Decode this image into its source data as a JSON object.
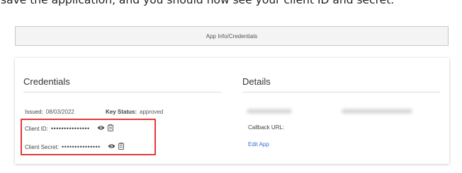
{
  "doc": {
    "text": "save the application, and you should now see your client ID and secret."
  },
  "tab": {
    "label": "App Info/Credentials"
  },
  "credentials": {
    "title": "Credentials",
    "issued_label": "Issued:",
    "issued_value": "08/03/2022",
    "key_status_label": "Key Status:",
    "key_status_value": "approved",
    "client_id_label": "Client ID:",
    "client_id_mask": "•••••••••••••••",
    "client_secret_label": "Client Secret:",
    "client_secret_mask": "•••••••••••••••"
  },
  "details": {
    "title": "Details",
    "callback_label": "Callback URL:",
    "edit_link": "Edit App"
  },
  "colors": {
    "highlight": "#e03b3b",
    "link": "#3a6ed8"
  },
  "icons": [
    "eye-icon",
    "clipboard-icon"
  ]
}
